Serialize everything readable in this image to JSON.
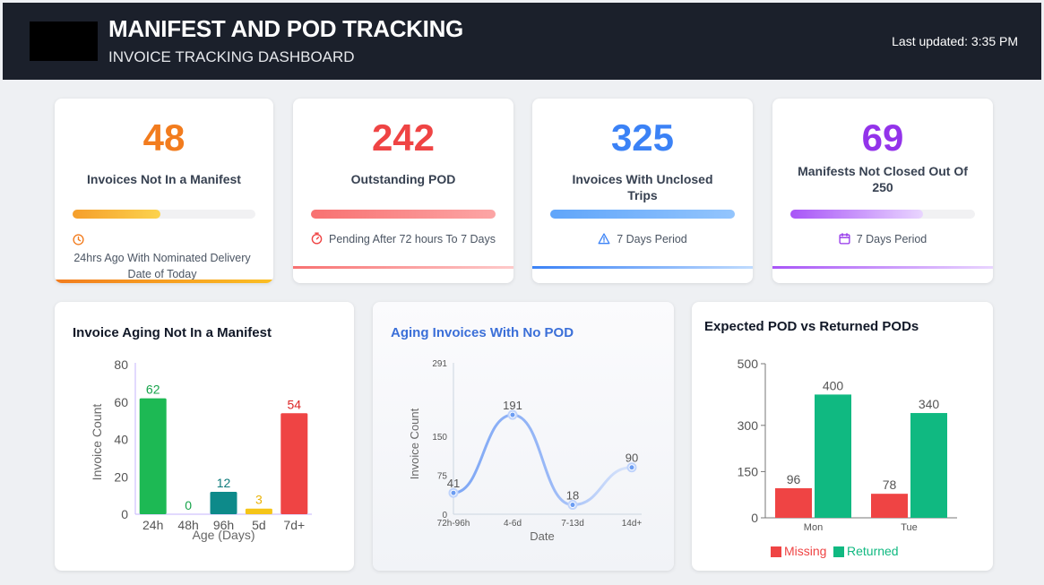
{
  "header": {
    "title": "MANIFEST AND POD TRACKING",
    "subtitle": "INVOICE TRACKING DASHBOARD",
    "last_updated": "Last updated: 3:35 PM"
  },
  "kpis": [
    {
      "value": "48",
      "label": "Invoices Not In a Manifest",
      "note": "24hrs Ago With Nominated Delivery Date of Today",
      "icon": "clock-icon",
      "color": "#f27c1e",
      "progress": 0.48
    },
    {
      "value": "242",
      "label": "Outstanding POD",
      "note": "Pending After 72 hours To 7 Days",
      "icon": "stopwatch-icon",
      "color": "#ef4444",
      "progress": 1.0
    },
    {
      "value": "325",
      "label": "Invoices With Unclosed Trips",
      "note": "7 Days Period",
      "icon": "warning-triangle-icon",
      "color": "#3b82f6",
      "progress": 1.0
    },
    {
      "value": "69",
      "label": "Manifests Not Closed Out Of 250",
      "note": "7 Days Period",
      "icon": "calendar-icon",
      "color": "#9333ea",
      "progress": 0.72
    }
  ],
  "charts": {
    "aging_manifest": {
      "title": "Invoice Aging Not In a Manifest",
      "xlabel": "Age (Days)",
      "ylabel": "Invoice Count"
    },
    "aging_pod": {
      "title": "Aging Invoices With No POD",
      "xlabel": "Date",
      "ylabel": "Invoice Count"
    },
    "expected_vs_returned": {
      "title": "Expected POD vs Returned PODs"
    }
  },
  "chart_data": [
    {
      "type": "bar",
      "title": "Invoice Aging Not In a Manifest",
      "xlabel": "Age (Days)",
      "ylabel": "Invoice Count",
      "categories": [
        "24h",
        "48h",
        "96h",
        "5d",
        "7d+"
      ],
      "values": [
        62,
        0,
        12,
        3,
        54
      ],
      "colors": [
        "#1db954",
        "#1db954",
        "#0d8a8a",
        "#f5c518",
        "#ef4444"
      ],
      "label_colors": [
        "#16a34a",
        "#16a34a",
        "#0d7a7a",
        "#eab308",
        "#dc2626"
      ],
      "yticks": [
        0,
        20,
        40,
        60,
        80
      ],
      "ylim": [
        0,
        80
      ]
    },
    {
      "type": "line",
      "title": "Aging Invoices With No POD",
      "xlabel": "Date",
      "ylabel": "Invoice Count",
      "categories": [
        "72h-96h",
        "4-6d",
        "7-13d",
        "14d+"
      ],
      "values": [
        41,
        191,
        18,
        90
      ],
      "yticks": [
        0,
        75,
        150,
        291
      ],
      "ylim": [
        0,
        291
      ]
    },
    {
      "type": "bar",
      "title": "Expected POD vs Returned PODs",
      "categories": [
        "Mon",
        "Tue"
      ],
      "series": [
        {
          "name": "Missing",
          "values": [
            96,
            78
          ],
          "color": "#ef4444"
        },
        {
          "name": "Returned",
          "values": [
            400,
            340
          ],
          "color": "#10b981"
        }
      ],
      "yticks": [
        0,
        150,
        300,
        500
      ],
      "ylim": [
        0,
        500
      ]
    }
  ]
}
